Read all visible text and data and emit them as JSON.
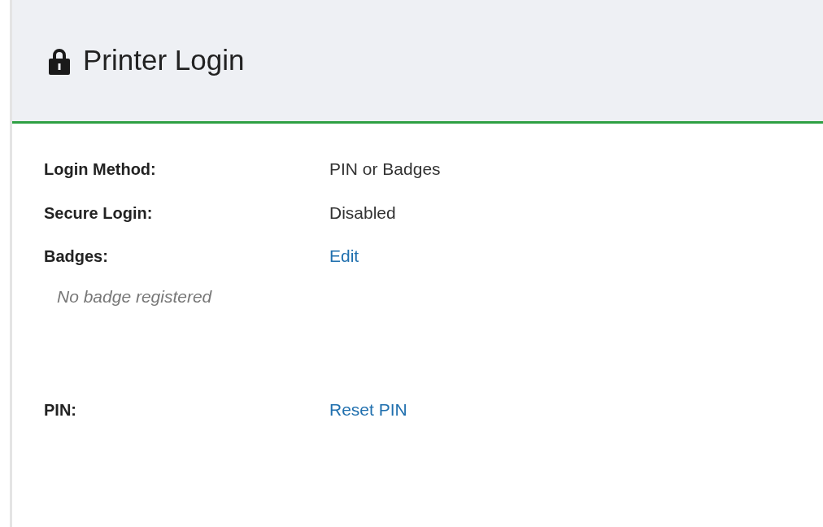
{
  "header": {
    "title": "Printer Login"
  },
  "fields": [
    {
      "label": "Login Method:",
      "kind": "text",
      "value": "PIN or Badges"
    },
    {
      "label": "Secure Login:",
      "kind": "text",
      "value": "Disabled"
    },
    {
      "label": "Badges:",
      "kind": "link",
      "value": "Edit",
      "note": "No badge registered"
    },
    {
      "label": "PIN:",
      "kind": "link",
      "value": "Reset PIN"
    }
  ]
}
